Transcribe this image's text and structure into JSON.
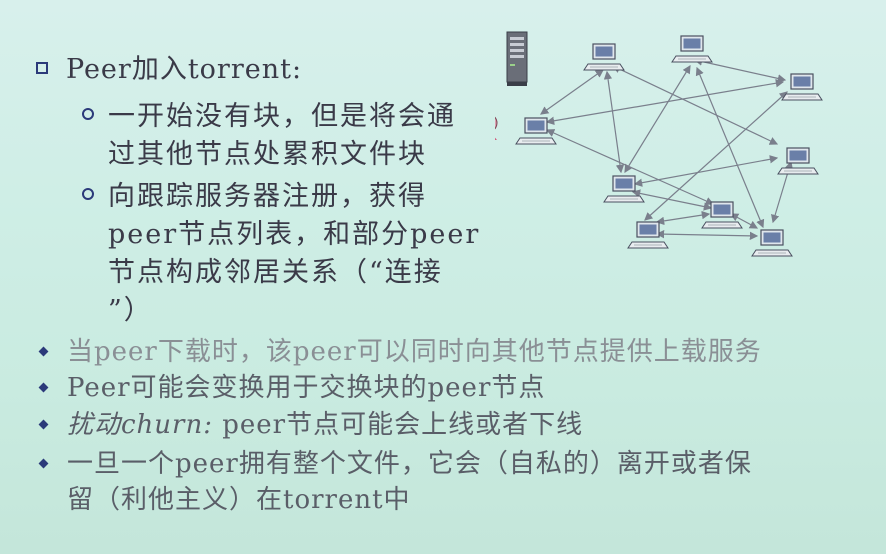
{
  "slide": {
    "main_bullet": "Peer加入torrent:",
    "sub_bullets": [
      {
        "lines": [
          "一开始没有块，但是将会通",
          "过其他节点处累积文件块"
        ]
      },
      {
        "lines": [
          "向跟踪服务器注册，获得",
          "peer节点列表，和部分peer",
          "节点构成邻居关系（“连接",
          "”）"
        ]
      }
    ],
    "bullets": [
      {
        "text": "当peer下载时，该peer可以同时向其他节点提供上载服务"
      },
      {
        "text": "Peer可能会变换用于交换块的peer节点"
      },
      {
        "label": "扰动churn:",
        "text": " peer节点可能会上线或者下线"
      },
      {
        "lines": [
          "一旦一个peer拥有整个文件，它会（自私的）离开或者保",
          "留（利他主义）在torrent中"
        ]
      }
    ]
  },
  "diagram": {
    "icons": [
      "server-icon",
      "user-icon",
      "computer-icon"
    ],
    "colors": {
      "bullet": "#2b3a7a",
      "arrow": "#7a7f8c",
      "screen": "#6a7fa8"
    }
  }
}
